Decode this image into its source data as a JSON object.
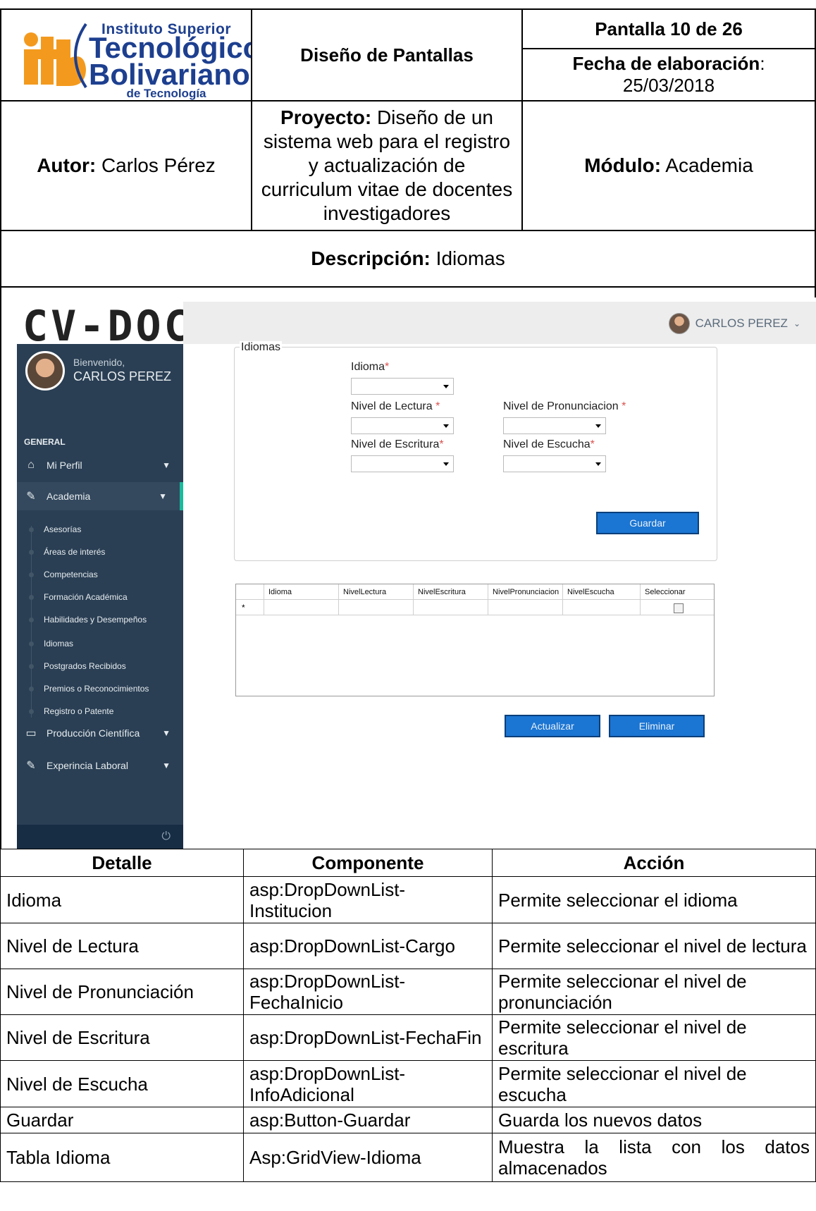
{
  "header": {
    "logo": {
      "line1": "Instituto Superior",
      "line2": "Tecnológico",
      "line3": "Bolivariano",
      "line4": "de Tecnología",
      "mark": "itb"
    },
    "title": "Diseño de Pantallas",
    "pantalla": "Pantalla 10 de 26",
    "fecha_label": "Fecha de elaboración",
    "fecha_colon": ":",
    "fecha_value": "25/03/2018",
    "autor_label": "Autor:",
    "autor_value": " Carlos Pérez",
    "proyecto_label": "Proyecto:",
    "proyecto_value": " Diseño de un sistema web para el registro y actualización de curriculum vitae de docentes investigadores",
    "modulo_label": "Módulo:",
    "modulo_value": " Academia",
    "descripcion_label": "Descripción:",
    "descripcion_value": " Idiomas"
  },
  "app": {
    "brand": "CV-DOC",
    "user_name": "CARLOS PEREZ",
    "welcome": "Bienvenido,",
    "section": "GENERAL",
    "menu": [
      {
        "label": "Mi Perfil",
        "icon": "home-icon"
      },
      {
        "label": "Academia",
        "icon": "edit-icon"
      },
      {
        "label": "Producción Científica",
        "icon": "monitor-icon"
      },
      {
        "label": "Experincia Laboral",
        "icon": "edit-icon"
      }
    ],
    "submenu": [
      "Asesorías",
      "Áreas de interés",
      "Competencias",
      "Formación Académica",
      "Habilidades y Desempeños",
      "Idiomas",
      "Postgrados Recibidos",
      "Premios o Reconocimientos",
      "Registro o Patente"
    ],
    "form": {
      "legend": "Idiomas",
      "idioma": "Idioma",
      "lectura": "Nivel de Lectura",
      "pronunciacion": "Nivel de Pronunciacion",
      "escritura": "Nivel de Escritura",
      "escucha": "Nivel de Escucha",
      "required_mark": "*",
      "guardar": "Guardar"
    },
    "grid": {
      "columns": [
        "Idioma",
        "NivelLectura",
        "NivelEscritura",
        "NivelPronunciacion",
        "NivelEscucha",
        "Seleccionar"
      ],
      "new_row_marker": "*"
    },
    "actualizar": "Actualizar",
    "eliminar": "Eliminar"
  },
  "table": {
    "headers": [
      "Detalle",
      "Componente",
      "Acción"
    ],
    "rows": [
      [
        "Idioma",
        "asp:DropDownList-Institucion",
        "Permite seleccionar el idioma"
      ],
      [
        "Nivel de Lectura",
        "asp:DropDownList-Cargo",
        "Permite seleccionar el nivel de lectura"
      ],
      [
        "Nivel de Pronunciación",
        "asp:DropDownList-FechaInicio",
        "Permite seleccionar el nivel de pronunciación"
      ],
      [
        "Nivel de Escritura",
        "asp:DropDownList-FechaFin",
        "Permite seleccionar el nivel de escritura"
      ],
      [
        "Nivel de Escucha",
        "asp:DropDownList-InfoAdicional",
        "Permite seleccionar el nivel de escucha"
      ],
      [
        "Guardar",
        "asp:Button-Guardar",
        "Guarda los nuevos datos"
      ],
      [
        "Tabla Idioma",
        "Asp:GridView-Idioma",
        "Muestra la lista con los datos almacenados"
      ]
    ]
  }
}
